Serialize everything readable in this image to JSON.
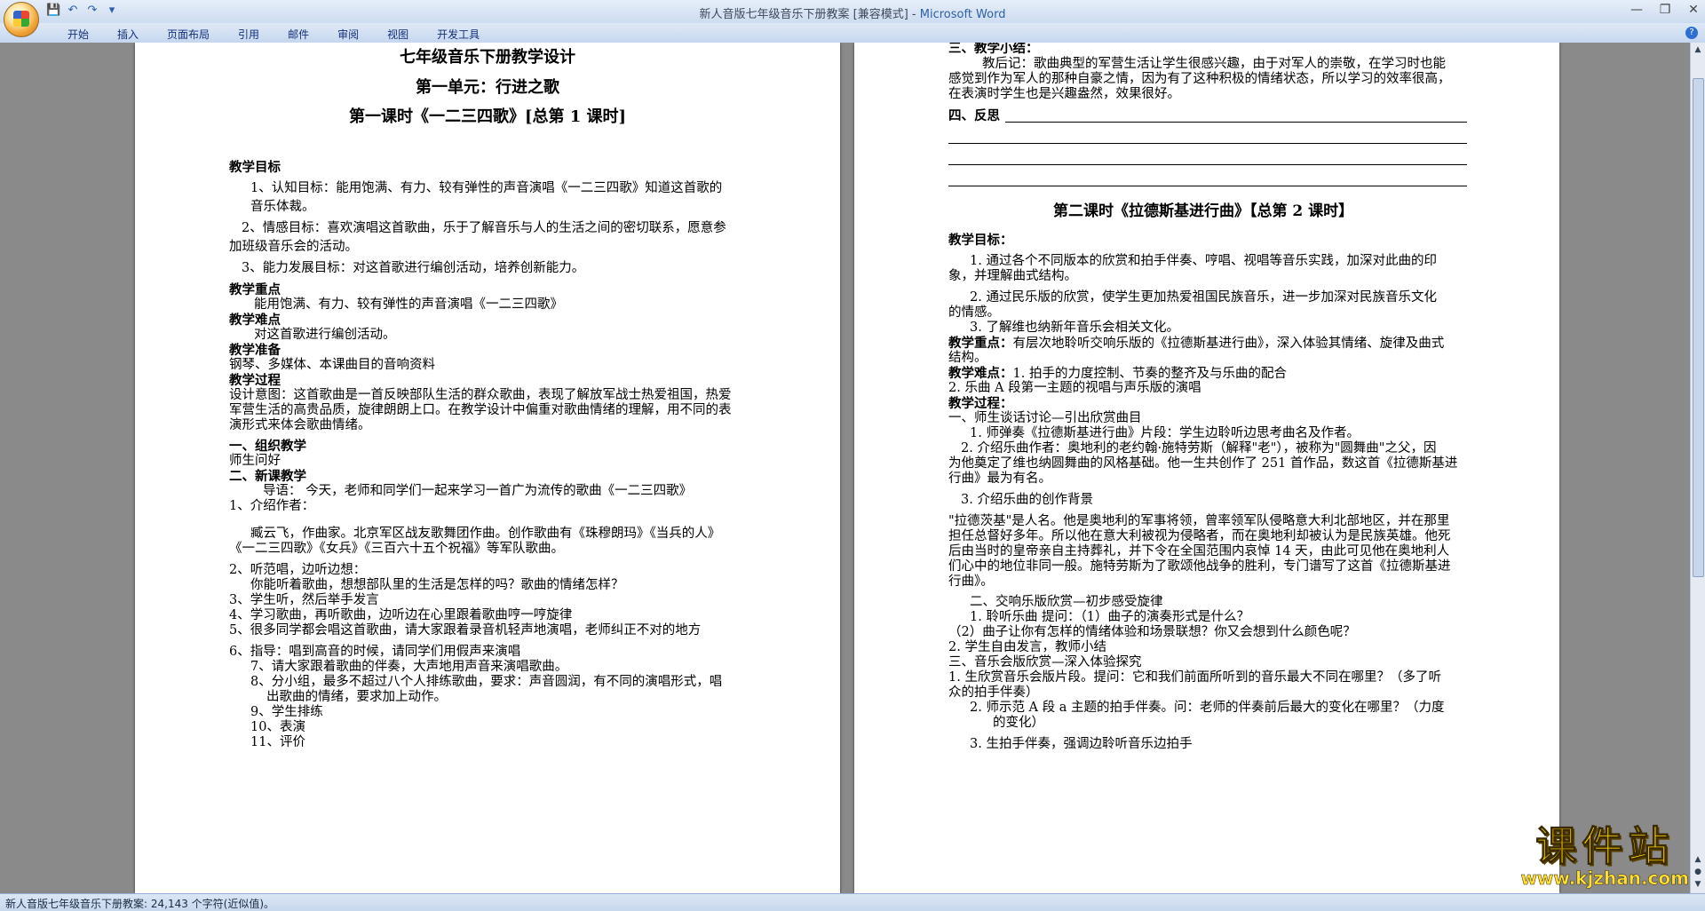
{
  "window": {
    "title": "新人音版七年级音乐下册教案 [兼容模式] - ",
    "app_name": "Microsoft Word"
  },
  "ribbon": {
    "tabs": [
      "开始",
      "插入",
      "页面布局",
      "引用",
      "邮件",
      "审阅",
      "视图",
      "开发工具"
    ]
  },
  "left_page": {
    "lines": [
      "七年级音乐下册教学设计",
      "第一单元：行进之歌",
      "第一课时《一二三四歌》[总第 1 课时]",
      "教学目标",
      "1、认知目标：能用饱满、有力、较有弹性的声音演唱《一二三四歌》知道这首歌的",
      "音乐体裁。",
      "2、情感目标：喜欢演唱这首歌曲，乐于了解音乐与人的生活之间的密切联系，愿意参",
      "加班级音乐会的活动。",
      "3、能力发展目标：对这首歌进行编创活动，培养创新能力。",
      "教学重点",
      "能用饱满、有力、较有弹性的声音演唱《一二三四歌》",
      "教学难点",
      "对这首歌进行编创活动。",
      "教学准备",
      "钢琴、多媒体、本课曲目的音响资料",
      "教学过程",
      "设计意图：这首歌曲是一首反映部队生活的群众歌曲，表现了解放军战士热爱祖国，热爱",
      "军营生活的高贵品质，旋律朗朗上口。在教学设计中偏重对歌曲情绪的理解，用不同的表",
      "演形式来体会歌曲情绪。",
      "一、组织教学",
      "师生问好",
      "二、新课教学",
      "导语：    今天，老师和同学们一起来学习一首广为流传的歌曲《一二三四歌》",
      "1、介绍作者：",
      "臧云飞，作曲家。北京军区战友歌舞团作曲。创作歌曲有《珠穆朗玛》《当兵的人》",
      "《一二三四歌》《女兵》《三百六十五个祝福》等军队歌曲。",
      "2、听范唱，边听边想：",
      "你能听着歌曲，想想部队里的生活是怎样的吗？歌曲的情绪怎样？",
      "3、学生听，然后举手发言",
      "4、学习歌曲，再听歌曲，边听边在心里跟着歌曲哼一哼旋律",
      "5、很多同学都会唱这首歌曲，请大家跟着录音机轻声地演唱，老师纠正不对的地方",
      "6、指导：唱到高音的时候，请同学们用假声来演唱",
      "7、请大家跟着歌曲的伴奏，大声地用声音来演唱歌曲。",
      "8、分小组，最多不超过八个人排练歌曲，要求：声音圆润，有不同的演唱形式，唱",
      "出歌曲的情绪，要求加上动作。",
      "9、学生排练",
      "10、表演",
      "11、评价"
    ]
  },
  "right_page": {
    "lines": [
      "三、教学小结：",
      "教后记：歌曲典型的军营生活让学生很感兴趣，由于对军人的崇敬，在学习时也能",
      "感觉到作为军人的那种自豪之情，因为有了这种积极的情绪状态，所以学习的效率很高，",
      "在表演时学生也是兴趣盎然，效果很好。",
      "四、反思",
      "第二课时《拉德斯基进行曲》【总第 2 课时】",
      "教学目标：",
      "1. 通过各个不同版本的欣赏和拍手伴奏、哼唱、视唱等音乐实践，加深对此曲的印",
      "象，并理解曲式结构。",
      "2. 通过民乐版的欣赏，使学生更加热爱祖国民族音乐，进一步加深对民族音乐文化",
      "的情感。",
      "3. 了解维也纳新年音乐会相关文化。",
      "教学重点：",
      "有层次地聆听交响乐版的《拉德斯基进行曲》，深入体验其情绪、旋律及曲式",
      "结构。",
      "教学难点：",
      "1. 拍手的力度控制、节奏的整齐及与乐曲的配合",
      "2. 乐曲 A 段第一主题的视唱与声乐版的演唱",
      "教学过程：",
      "一、师生谈话讨论—引出欣赏曲目",
      "1. 师弹奏《拉德斯基进行曲》片段：学生边聆听边思考曲名及作者。",
      "2. 介绍乐曲作者：奥地利的老约翰·施特劳斯（解释\"老\"），被称为\"圆舞曲\"之父，因",
      "为他奠定了维也纳圆舞曲的风格基础。他一生共创作了 251 首作品，数这首《拉德斯基进",
      "行曲》最为有名。",
      "3. 介绍乐曲的创作背景",
      "\"拉德茨基\"是人名。他是奥地利的军事将领，曾率领军队侵略意大利北部地区，并在那里",
      "担任总督好多年。所以他在意大利被视为侵略者，而在奥地利却被认为是民族英雄。他死",
      "后由当时的皇帝亲自主持葬礼，并下令在全国范围内哀悼 14 天，由此可见他在奥地利人",
      "们心中的地位非同一般。施特劳斯为了歌颂他战争的胜利，专门谱写了这首《拉德斯基进",
      "行曲》。",
      "二、交响乐版欣赏—初步感受旋律",
      "1. 聆听乐曲    提问：（1）曲子的演奏形式是什么？",
      "（2）曲子让你有怎样的情绪体验和场景联想？你又会想到什么颜色呢？",
      "2. 学生自由发言，教师小结",
      "三、音乐会版欣赏—深入体验探究",
      "1. 生欣赏音乐会版片段。提问：它和我们前面所听到的音乐最大不同在哪里？（多了听",
      "众的拍手伴奏）",
      "2. 师示范 A 段 a 主题的拍手伴奏。问：老师的伴奏前后最大的变化在哪里？（力度",
      "的变化）",
      "3. 生拍手伴奏，强调边聆听音乐边拍手"
    ]
  },
  "status_bar": {
    "text": "新人音版七年级音乐下册教案: 24,143 个字符(近似值)。"
  },
  "watermark": {
    "title": "课件站",
    "url": "www.kjzhan.com"
  }
}
